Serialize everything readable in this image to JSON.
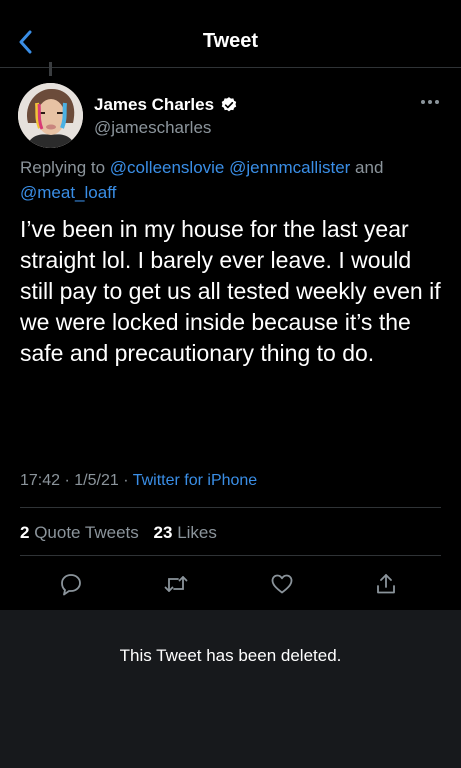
{
  "header": {
    "title": "Tweet"
  },
  "tweet": {
    "author_name": "James Charles",
    "author_handle": "@jamescharles",
    "replying_prefix": "Replying to",
    "reply_handle_1": "@colleenslovie",
    "reply_handle_2": "@jennmcallister",
    "reply_and": "and",
    "reply_handle_3": "@meat_loaff",
    "text": "I’ve been in my house for the last year straight lol. I barely ever leave. I would still pay to get us all tested weekly even if we were locked inside because it’s the safe and precautionary thing to do.",
    "time": "17:42",
    "date": "1/5/21",
    "separator": "·",
    "source": "Twitter for iPhone"
  },
  "stats": {
    "quote_count": "2",
    "quote_label": "Quote Tweets",
    "like_count": "23",
    "like_label": "Likes"
  },
  "deleted_notice": "This Tweet has been deleted.",
  "colors": {
    "link": "#3a8ee6",
    "muted": "#8b949b",
    "background": "#000000",
    "deleted_bg": "#17191c"
  },
  "icons": [
    "back-chevron-icon",
    "verified-badge-icon",
    "more-options-icon",
    "reply-icon",
    "retweet-icon",
    "like-icon",
    "share-icon"
  ]
}
